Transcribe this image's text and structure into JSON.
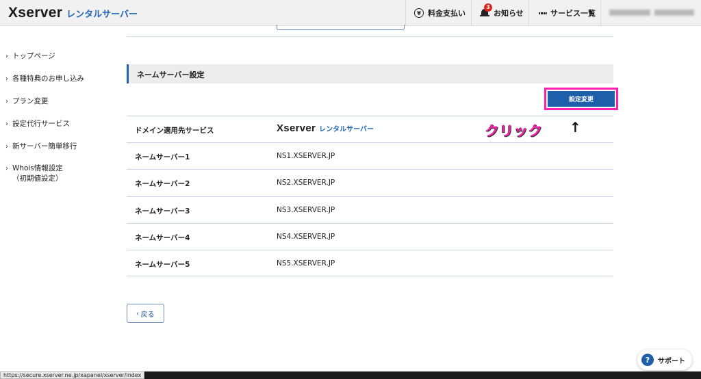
{
  "header": {
    "logo_main": "Xserver",
    "logo_sub": "レンタルサーバー",
    "nav": {
      "billing": "料金支払い",
      "notifications": "お知らせ",
      "notification_count": "3",
      "services": "サービス一覧"
    }
  },
  "sidebar": {
    "items": [
      {
        "label": "トップページ"
      },
      {
        "label": "各種特典のお申し込み"
      },
      {
        "label": "プラン変更"
      },
      {
        "label": "設定代行サービス"
      },
      {
        "label": "新サーバー簡単移行"
      },
      {
        "label": "Whois情報設定",
        "sub": "（初期値設定）"
      }
    ]
  },
  "main": {
    "section_title": "ネームサーバー設定",
    "change_button": "設定変更",
    "annotation_text": "クリック",
    "annotation_arrow": "↑",
    "rows": [
      {
        "label": "ドメイン適用先サービス",
        "logo_main": "Xserver",
        "logo_sub": "レンタルサーバー"
      },
      {
        "label": "ネームサーバー1",
        "value": "NS1.XSERVER.JP"
      },
      {
        "label": "ネームサーバー2",
        "value": "NS2.XSERVER.JP"
      },
      {
        "label": "ネームサーバー3",
        "value": "NS3.XSERVER.JP"
      },
      {
        "label": "ネームサーバー4",
        "value": "NS4.XSERVER.JP"
      },
      {
        "label": "ネームサーバー5",
        "value": "NS5.XSERVER.JP"
      }
    ],
    "back_button": "戻る"
  },
  "support_button": "サポート",
  "status_url": "https://secure.xserver.ne.jp/xapanel/xserver/index",
  "colors": {
    "accent": "#1f5ea8",
    "highlight": "#ff1fae",
    "badge": "#e0241b"
  }
}
